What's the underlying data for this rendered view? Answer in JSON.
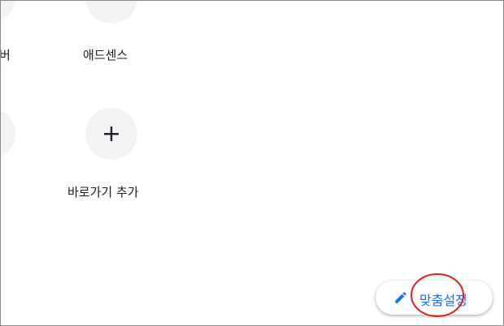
{
  "shortcuts": [
    {
      "label": "버",
      "icon": "partial-shortcut-icon"
    },
    {
      "label": "애드센스",
      "icon": "adsense-icon"
    },
    {
      "label": "",
      "icon": "partial-shortcut-icon"
    },
    {
      "label": "바로가기 추가",
      "icon": "plus-icon"
    }
  ],
  "customize_button": {
    "label": "맞춤설정",
    "icon": "pencil-icon"
  },
  "colors": {
    "accent": "#1a73e8",
    "circle_bg": "#f1f3f4",
    "annotation": "#e0201a",
    "adsense_green": "#34a853"
  }
}
